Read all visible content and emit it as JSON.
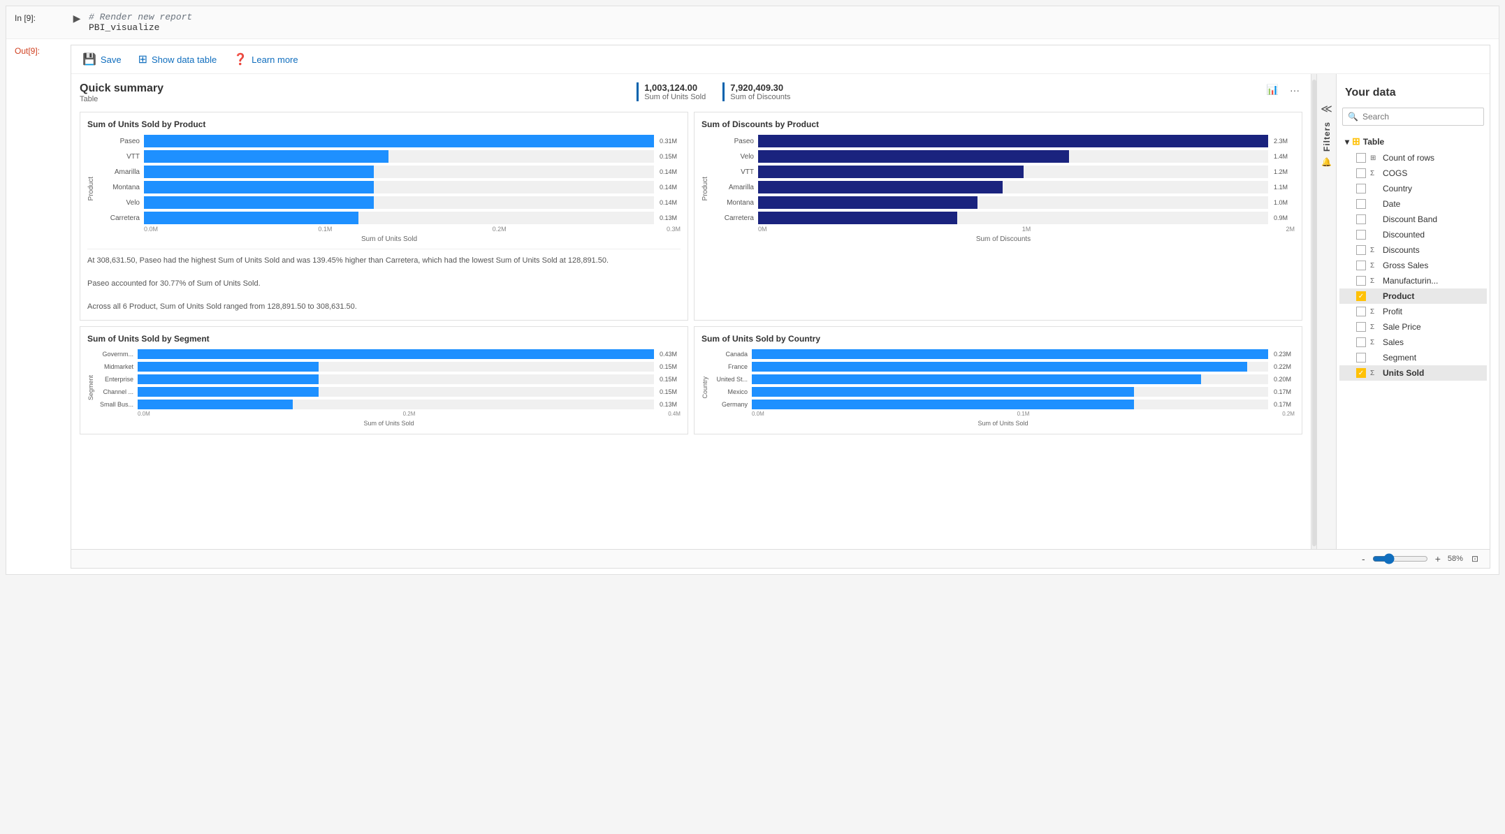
{
  "cell_input": {
    "label": "In [9]:",
    "comment": "# Render new report",
    "code": "PBI_visualize"
  },
  "cell_output": {
    "label": "Out[9]:"
  },
  "toolbar": {
    "save_label": "Save",
    "show_data_label": "Show data table",
    "learn_more_label": "Learn more"
  },
  "quick_summary": {
    "title": "Quick summary",
    "subtitle": "Table",
    "kpi1_value": "1,003,124.00",
    "kpi1_label": "Sum of Units Sold",
    "kpi2_value": "7,920,409.30",
    "kpi2_label": "Sum of Discounts"
  },
  "chart1": {
    "title": "Sum of Units Sold by Product",
    "x_label": "Sum of Units Sold",
    "y_label": "Product",
    "ticks": [
      "0.0M",
      "0.1M",
      "0.2M",
      "0.3M"
    ],
    "bars": [
      {
        "label": "Paseo",
        "value": "0.31M",
        "pct": 100
      },
      {
        "label": "VTT",
        "value": "0.15M",
        "pct": 48
      },
      {
        "label": "Amarilla",
        "value": "0.14M",
        "pct": 45
      },
      {
        "label": "Montana",
        "value": "0.14M",
        "pct": 45
      },
      {
        "label": "Velo",
        "value": "0.14M",
        "pct": 45
      },
      {
        "label": "Carretera",
        "value": "0.13M",
        "pct": 42
      }
    ]
  },
  "chart2": {
    "title": "Sum of Discounts by Product",
    "x_label": "Sum of Discounts",
    "y_label": "Product",
    "ticks": [
      "0M",
      "1M",
      "2M"
    ],
    "bars": [
      {
        "label": "Paseo",
        "value": "2.3M",
        "pct": 100
      },
      {
        "label": "Velo",
        "value": "1.4M",
        "pct": 61
      },
      {
        "label": "VTT",
        "value": "1.2M",
        "pct": 52
      },
      {
        "label": "Amarilla",
        "value": "1.1M",
        "pct": 48
      },
      {
        "label": "Montana",
        "value": "1.0M",
        "pct": 43
      },
      {
        "label": "Carretera",
        "value": "0.9M",
        "pct": 39
      }
    ]
  },
  "chart3": {
    "title": "Sum of Units Sold by Segment",
    "x_label": "Sum of Units Sold",
    "y_label": "Segment",
    "ticks": [
      "0.0M",
      "0.2M",
      "0.4M"
    ],
    "bars": [
      {
        "label": "Governm...",
        "value": "0.43M",
        "pct": 100
      },
      {
        "label": "Midmarket",
        "value": "0.15M",
        "pct": 35
      },
      {
        "label": "Enterprise",
        "value": "0.15M",
        "pct": 35
      },
      {
        "label": "Channel ...",
        "value": "0.15M",
        "pct": 35
      },
      {
        "label": "Small Bus...",
        "value": "0.13M",
        "pct": 30
      }
    ]
  },
  "chart4": {
    "title": "Sum of Units Sold by Country",
    "x_label": "Sum of Units Sold",
    "y_label": "Country",
    "ticks": [
      "0.0M",
      "0.1M",
      "0.2M"
    ],
    "bars": [
      {
        "label": "Canada",
        "value": "0.23M",
        "pct": 100
      },
      {
        "label": "France",
        "value": "0.22M",
        "pct": 96
      },
      {
        "label": "United St...",
        "value": "0.20M",
        "pct": 87
      },
      {
        "label": "Mexico",
        "value": "0.17M",
        "pct": 74
      },
      {
        "label": "Germany",
        "value": "0.17M",
        "pct": 74
      }
    ]
  },
  "insights": {
    "line1": "At 308,631.50,  Paseo had the highest Sum of Units Sold and was 139.45% higher than  Carretera, which had the lowest Sum of Units Sold at 128,891.50.",
    "line2": "Paseo accounted for 30.77% of Sum of Units Sold.",
    "line3": "Across all 6 Product, Sum of Units Sold ranged from 128,891.50 to 308,631.50."
  },
  "data_panel": {
    "title": "Your data",
    "search_placeholder": "Search",
    "table_name": "Table",
    "fields": [
      {
        "name": "Count of rows",
        "type": "grid",
        "selected": false,
        "sigma": false
      },
      {
        "name": "COGS",
        "type": "sigma",
        "selected": false,
        "sigma": true
      },
      {
        "name": "Country",
        "type": "",
        "selected": false,
        "sigma": false
      },
      {
        "name": "Date",
        "type": "",
        "selected": false,
        "sigma": false
      },
      {
        "name": "Discount Band",
        "type": "",
        "selected": false,
        "sigma": false
      },
      {
        "name": "Discounted",
        "type": "",
        "selected": false,
        "sigma": false
      },
      {
        "name": "Discounts",
        "type": "sigma",
        "selected": false,
        "sigma": true
      },
      {
        "name": "Gross Sales",
        "type": "sigma",
        "selected": false,
        "sigma": true
      },
      {
        "name": "Manufacturin...",
        "type": "sigma",
        "selected": false,
        "sigma": true
      },
      {
        "name": "Product",
        "type": "",
        "selected": true,
        "sigma": false
      },
      {
        "name": "Profit",
        "type": "sigma",
        "selected": false,
        "sigma": true
      },
      {
        "name": "Sale Price",
        "type": "sigma",
        "selected": false,
        "sigma": true
      },
      {
        "name": "Sales",
        "type": "sigma",
        "selected": false,
        "sigma": true
      },
      {
        "name": "Segment",
        "type": "",
        "selected": false,
        "sigma": false
      },
      {
        "name": "Units Sold",
        "type": "sigma",
        "selected": true,
        "sigma": true
      }
    ]
  },
  "status_bar": {
    "zoom_label": "58%",
    "minus": "-",
    "plus": "+"
  },
  "filters": {
    "label": "Filters"
  }
}
